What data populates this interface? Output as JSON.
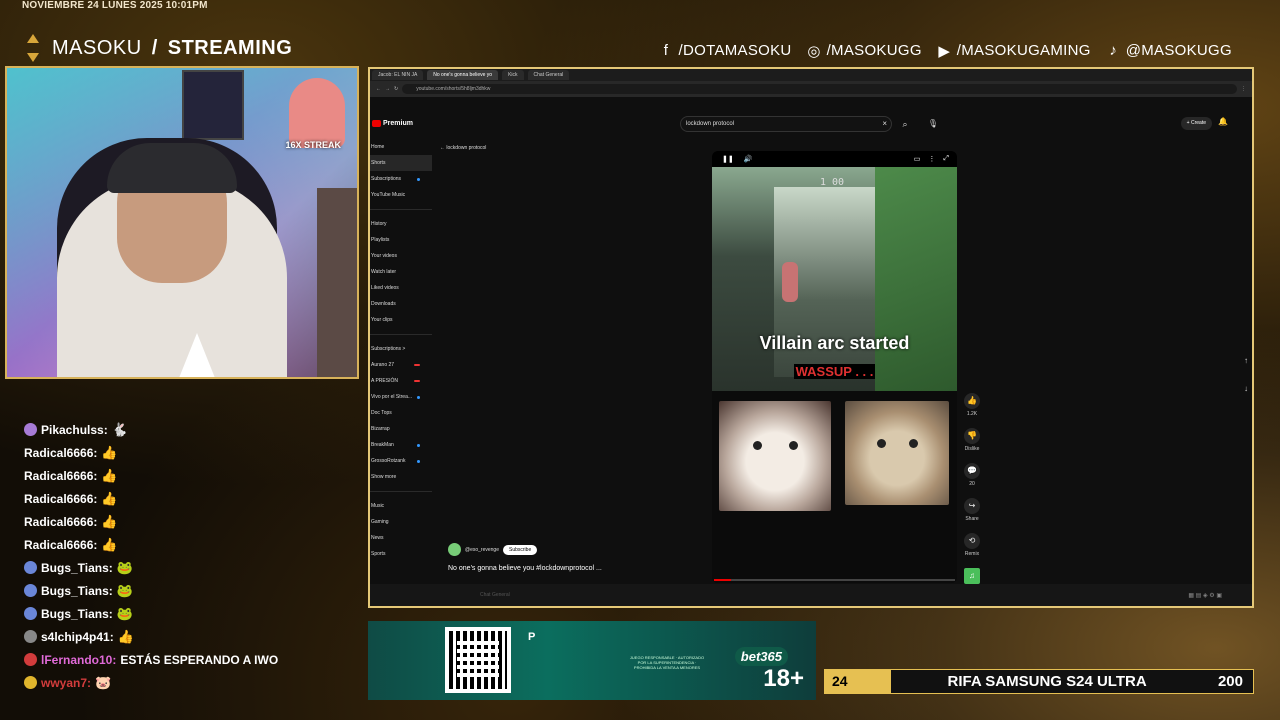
{
  "overlay": {
    "datetime": "NOVIEMBRE 24 LUNES 2025 10:01PM",
    "brand_name": "MASOKU",
    "brand_separator": "/",
    "brand_suffix": "STREAMING",
    "accent_color": "#d8a63a",
    "socials": [
      {
        "icon": "facebook-icon",
        "glyph": "f",
        "handle": "/DOTAMASOKU"
      },
      {
        "icon": "instagram-icon",
        "glyph": "◎",
        "handle": "/MASOKUGG"
      },
      {
        "icon": "youtube-icon",
        "glyph": "▶",
        "handle": "/MASOKUGAMING"
      },
      {
        "icon": "tiktok-icon",
        "glyph": "♪",
        "handle": "@MASOKUGG"
      }
    ]
  },
  "webcam": {
    "streak_label": "16X STREAK"
  },
  "chat": {
    "messages": [
      {
        "user": "Pikachulss:",
        "badge_color": "#a77bd6",
        "emote": "🐇",
        "text": "",
        "name_color": "#ffffff"
      },
      {
        "user": "Radical6666:",
        "badge_color": "",
        "emote": "👍",
        "text": "",
        "name_color": "#ffffff"
      },
      {
        "user": "Radical6666:",
        "badge_color": "",
        "emote": "👍",
        "text": "",
        "name_color": "#ffffff"
      },
      {
        "user": "Radical6666:",
        "badge_color": "",
        "emote": "👍",
        "text": "",
        "name_color": "#ffffff"
      },
      {
        "user": "Radical6666:",
        "badge_color": "",
        "emote": "👍",
        "text": "",
        "name_color": "#ffffff"
      },
      {
        "user": "Radical6666:",
        "badge_color": "",
        "emote": "👍",
        "text": "",
        "name_color": "#ffffff"
      },
      {
        "user": "Bugs_Tians:",
        "badge_color": "#6a86d8",
        "emote": "🐸",
        "text": "",
        "name_color": "#ffffff"
      },
      {
        "user": "Bugs_Tians:",
        "badge_color": "#6a86d8",
        "emote": "🐸",
        "text": "",
        "name_color": "#ffffff"
      },
      {
        "user": "Bugs_Tians:",
        "badge_color": "#6a86d8",
        "emote": "🐸",
        "text": "",
        "name_color": "#ffffff"
      },
      {
        "user": "s4lchip4p41:",
        "badge_color": "#888888",
        "emote": "👍",
        "text": "",
        "name_color": "#ffffff"
      },
      {
        "user": "lFernando10:",
        "badge_color": "#d23c3c",
        "emote": "",
        "text": "ESTÁS ESPERANDO A IWO",
        "name_color": "#e06ad8"
      },
      {
        "user": "wwyan7:",
        "badge_color": "#e0b52c",
        "emote": "🐷",
        "text": "",
        "name_color": "#d23c3c"
      }
    ]
  },
  "browser": {
    "tabs": [
      {
        "label": "Jacob: EL NIN JA",
        "active": false
      },
      {
        "label": "No one's gonna believe yo",
        "active": true
      },
      {
        "label": "Kick",
        "active": false
      },
      {
        "label": "Chat General",
        "active": false
      }
    ],
    "url": "youtube.com/shorts/5h8ljm3dhkw",
    "youtube": {
      "logo_text": "Premium",
      "search_value": "lockdown protocol",
      "create_label": "+ Create",
      "back_label": "lockdown protocol",
      "sidebar": [
        {
          "label": "Home",
          "active": false,
          "dot": ""
        },
        {
          "label": "Shorts",
          "active": true,
          "dot": ""
        },
        {
          "label": "Subscriptions",
          "active": false,
          "dot": "blue"
        },
        {
          "label": "YouTube Music",
          "active": false,
          "dot": ""
        },
        {
          "sep": true
        },
        {
          "label": "History",
          "active": false,
          "dot": ""
        },
        {
          "label": "Playlists",
          "active": false,
          "dot": ""
        },
        {
          "label": "Your videos",
          "active": false,
          "dot": ""
        },
        {
          "label": "Watch later",
          "active": false,
          "dot": ""
        },
        {
          "label": "Liked videos",
          "active": false,
          "dot": ""
        },
        {
          "label": "Downloads",
          "active": false,
          "dot": ""
        },
        {
          "label": "Your clips",
          "active": false,
          "dot": ""
        },
        {
          "sep": true
        },
        {
          "label": "Subscriptions >",
          "active": false,
          "dot": ""
        },
        {
          "label": "Aurano 27",
          "active": false,
          "dot": "red"
        },
        {
          "label": "A PRESIÓN",
          "active": false,
          "dot": "red"
        },
        {
          "label": "Vivo por el Strea...",
          "active": false,
          "dot": "blue"
        },
        {
          "label": "Doc Tops",
          "active": false,
          "dot": ""
        },
        {
          "label": "Bizarrap",
          "active": false,
          "dot": ""
        },
        {
          "label": "BreakMan",
          "active": false,
          "dot": "blue"
        },
        {
          "label": "GrossoRotzank",
          "active": false,
          "dot": "blue"
        },
        {
          "label": "Show more",
          "active": false,
          "dot": ""
        },
        {
          "sep": true
        },
        {
          "label": "Music",
          "active": false,
          "dot": ""
        },
        {
          "label": "Gaming",
          "active": false,
          "dot": ""
        },
        {
          "label": "News",
          "active": false,
          "dot": ""
        },
        {
          "label": "Sports",
          "active": false,
          "dot": ""
        }
      ],
      "short": {
        "hud_text": "1  00",
        "caption_main": "Villain arc started",
        "caption_sub": "WASSUP . . .",
        "progress": 0.07,
        "channel": "@eso_revenge",
        "subscribe_label": "Subscribe",
        "description": "No one's gonna believe you #lockdownprotocol ..."
      },
      "actions": [
        {
          "name": "like",
          "glyph": "👍",
          "label": "1.2K"
        },
        {
          "name": "dislike",
          "glyph": "👎",
          "label": "Dislike"
        },
        {
          "name": "comments",
          "glyph": "💬",
          "label": "20"
        },
        {
          "name": "share",
          "glyph": "↪",
          "label": "Share"
        },
        {
          "name": "remix",
          "glyph": "⟲",
          "label": "Remix"
        },
        {
          "name": "sound",
          "glyph": "♫",
          "label": ""
        }
      ],
      "bottom_bar_text": "Chat General"
    }
  },
  "ad": {
    "letter": "P",
    "logo": "bet365",
    "age": "18+",
    "legal": "JUEGO RESPONSABLE · AUTORIZADO POR LA SUPERINTENDENCIA · PROHIBIDA LA VENTA A MENORES"
  },
  "raffle": {
    "count": 24,
    "title": "RIFA SAMSUNG S24 ULTRA",
    "goal": 200,
    "progress": 0.12,
    "color": "#e6c052"
  }
}
